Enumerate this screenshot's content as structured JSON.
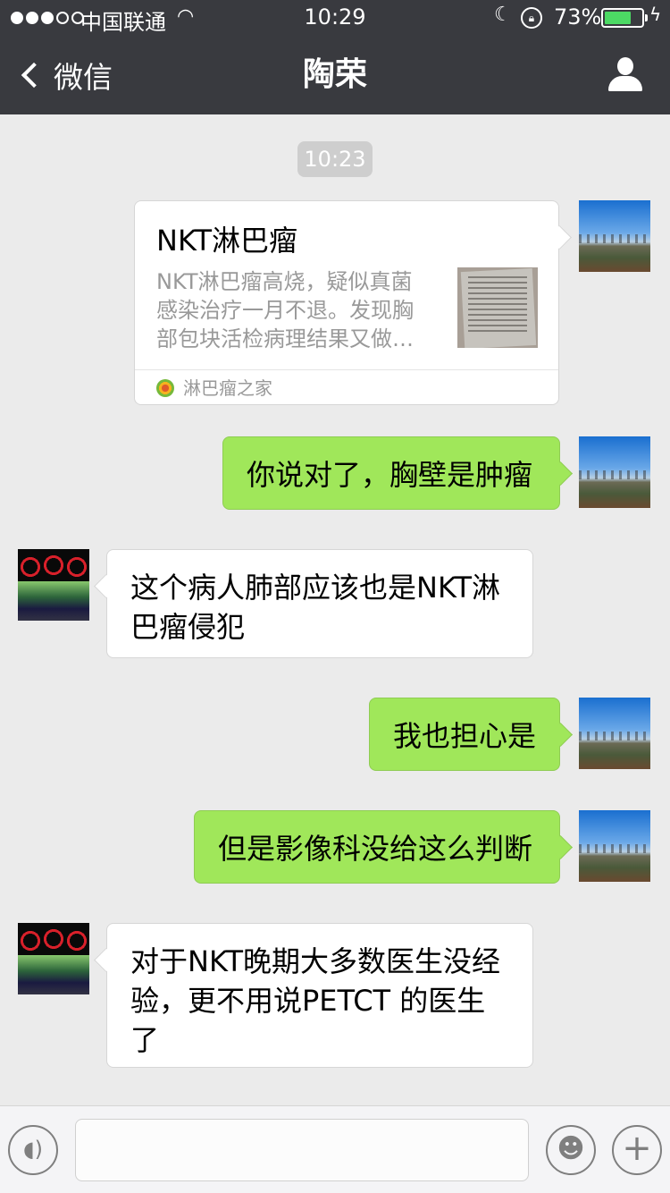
{
  "status_bar": {
    "carrier": "中国联通",
    "time": "10:29",
    "battery_percent": "73%",
    "battery_level": 0.73
  },
  "nav": {
    "back_label": "微信",
    "title": "陶荣"
  },
  "chat": {
    "timestamp": "10:23",
    "link_card": {
      "title": "NKT淋巴瘤",
      "description": "NKT淋巴瘤高烧，疑似真菌感染治疗一月不退。发现胸部包块活检病理结果又做…",
      "source": "淋巴瘤之家"
    },
    "messages": [
      {
        "side": "me",
        "text": "你说对了，胸壁是肿瘤"
      },
      {
        "side": "other",
        "text": "这个病人肺部应该也是NKT淋巴瘤侵犯"
      },
      {
        "side": "me",
        "text": "我也担心是"
      },
      {
        "side": "me",
        "text": "但是影像科没给这么判断"
      },
      {
        "side": "other",
        "text": "对于NKT晚期大多数医生没经验，更不用说PETCT 的医生了"
      }
    ]
  },
  "input_bar": {
    "text_value": ""
  },
  "colors": {
    "nav_bg": "#393a3f",
    "chat_bg": "#ebebeb",
    "my_bubble": "#a0e75a",
    "other_bubble": "#ffffff"
  }
}
